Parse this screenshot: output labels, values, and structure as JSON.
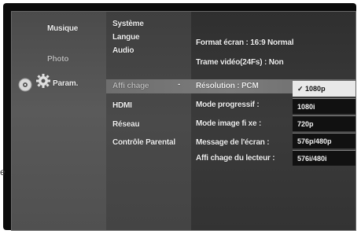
{
  "main_menu": {
    "items": [
      {
        "label": "Musique"
      },
      {
        "label": "Photo"
      },
      {
        "label": "Param."
      }
    ]
  },
  "settings_menu": {
    "items": [
      {
        "label": "Système"
      },
      {
        "label": "Langue"
      },
      {
        "label": "Audio"
      },
      {
        "label": "Affi chage"
      },
      {
        "label": "HDMI"
      },
      {
        "label": "Réseau"
      },
      {
        "label": "Contrôle Parental"
      }
    ],
    "submenu_arrow": "-"
  },
  "options": {
    "format_ecran": "Format écran :  16:9 Normal",
    "trame_video": "Trame vidéo(24Fs) :  Non",
    "resolution": "Résolution  : PCM",
    "mode_progressif": "Mode progressif :",
    "mode_image_fixe": "Mode image fi xe :",
    "message_ecran": "Message de l'écran  :",
    "affichage_lecteur": "Affi chage du lecteur :"
  },
  "resolution_dropdown": {
    "options": [
      {
        "label": "✓ 1080p",
        "selected": true
      },
      {
        "label": "1080i",
        "selected": false
      },
      {
        "label": "720p",
        "selected": false
      },
      {
        "label": "576p/480p",
        "selected": false
      },
      {
        "label": "576i/480i",
        "selected": false
      }
    ]
  },
  "edge_text": "e",
  "icons": {
    "music": "disc-icon",
    "settings": "gear-icon"
  }
}
